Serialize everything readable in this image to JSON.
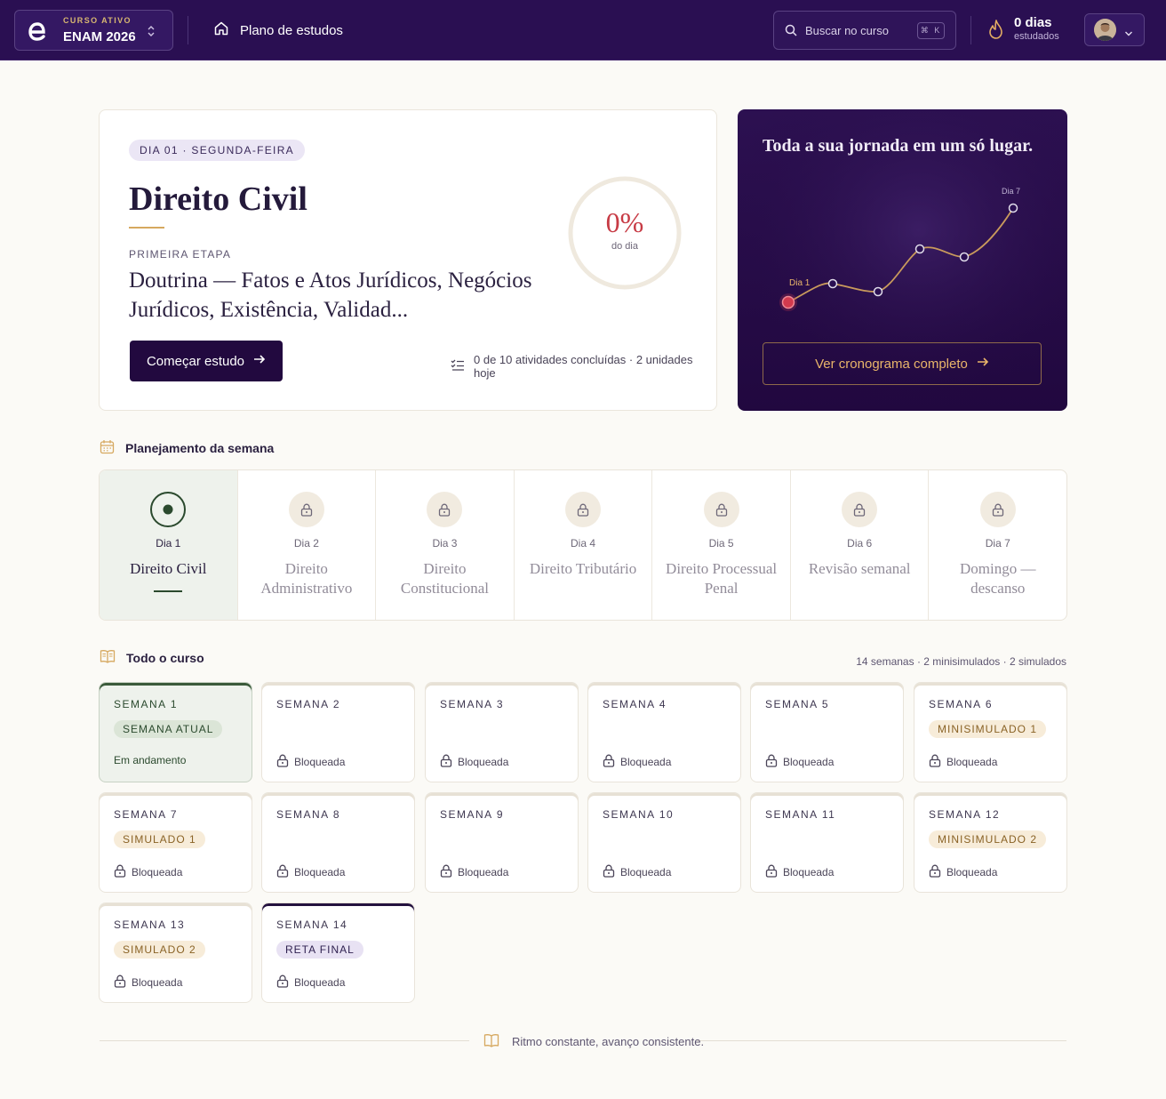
{
  "topbar": {
    "course_kicker": "CURSO ATIVO",
    "course_name": "ENAM 2026",
    "plan_link": "Plano de estudos",
    "search_placeholder": "Buscar no curso",
    "search_shortcut": "⌘ K",
    "streak_count": "0 dias",
    "streak_label": "estudados"
  },
  "hero": {
    "day_chip": "DIA 01 · SEGUNDA-FEIRA",
    "title": "Direito Civil",
    "stage_label": "PRIMEIRA ETAPA",
    "subtitle": "Doutrina — Fatos e Atos Jurídicos, Negócios Jurídicos, Existência, Validad...",
    "start_button": "Começar estudo",
    "activities_text": "0 de 10 atividades concluídas · 2 unidades hoje",
    "progress_percent": "0%",
    "progress_value": 0,
    "progress_label": "do dia"
  },
  "journey": {
    "title": "Toda a sua jornada em um só lugar.",
    "start_label": "Dia 1",
    "end_label": "Dia 7",
    "button": "Ver cronograma completo"
  },
  "week_planner": {
    "title": "Planejamento da semana",
    "days": [
      {
        "label": "Dia 1",
        "subject": "Direito Civil",
        "state": "active"
      },
      {
        "label": "Dia 2",
        "subject": "Direito Administrativo",
        "state": "locked"
      },
      {
        "label": "Dia 3",
        "subject": "Direito Constitucional",
        "state": "locked"
      },
      {
        "label": "Dia 4",
        "subject": "Direito Tributário",
        "state": "locked"
      },
      {
        "label": "Dia 5",
        "subject": "Direito Processual Penal",
        "state": "locked"
      },
      {
        "label": "Dia 6",
        "subject": "Revisão semanal",
        "state": "locked"
      },
      {
        "label": "Dia 7",
        "subject": "Domingo — descanso",
        "state": "locked"
      }
    ]
  },
  "course": {
    "title": "Todo o curso",
    "meta": "14 semanas · 2 minisimulados · 2 simulados",
    "weeks": [
      {
        "title": "SEMANA 1",
        "badge": "SEMANA ATUAL",
        "badge_type": "current",
        "status": "Em andamento"
      },
      {
        "title": "SEMANA 2",
        "badge": "",
        "badge_type": "",
        "status": "Bloqueada"
      },
      {
        "title": "SEMANA 3",
        "badge": "",
        "badge_type": "",
        "status": "Bloqueada"
      },
      {
        "title": "SEMANA 4",
        "badge": "",
        "badge_type": "",
        "status": "Bloqueada"
      },
      {
        "title": "SEMANA 5",
        "badge": "",
        "badge_type": "",
        "status": "Bloqueada"
      },
      {
        "title": "SEMANA 6",
        "badge": "MINISIMULADO 1",
        "badge_type": "mini",
        "status": "Bloqueada"
      },
      {
        "title": "SEMANA 7",
        "badge": "SIMULADO 1",
        "badge_type": "sim",
        "status": "Bloqueada"
      },
      {
        "title": "SEMANA 8",
        "badge": "",
        "badge_type": "",
        "status": "Bloqueada"
      },
      {
        "title": "SEMANA 9",
        "badge": "",
        "badge_type": "",
        "status": "Bloqueada"
      },
      {
        "title": "SEMANA 10",
        "badge": "",
        "badge_type": "",
        "status": "Bloqueada"
      },
      {
        "title": "SEMANA 11",
        "badge": "",
        "badge_type": "",
        "status": "Bloqueada"
      },
      {
        "title": "SEMANA 12",
        "badge": "MINISIMULADO 2",
        "badge_type": "mini",
        "status": "Bloqueada"
      },
      {
        "title": "SEMANA 13",
        "badge": "SIMULADO 2",
        "badge_type": "sim",
        "status": "Bloqueada"
      },
      {
        "title": "SEMANA 14",
        "badge": "RETA FINAL",
        "badge_type": "final",
        "status": "Bloqueada"
      }
    ]
  },
  "footer": {
    "text": "Ritmo constante, avanço consistente."
  },
  "icons": {
    "logo": "brand-e-logo",
    "home": "home-icon",
    "search": "search-icon",
    "streak": "flame-icon",
    "calendar": "calendar-icon",
    "book": "book-open-icon",
    "lock": "lock-icon",
    "checklist": "checklist-icon",
    "arrow": "arrow-right-icon"
  },
  "colors": {
    "brand_purple": "#2a0f52",
    "accent_gold": "#d6a85f",
    "accent_red": "#c73b45",
    "success_green": "#2b4a2e"
  }
}
